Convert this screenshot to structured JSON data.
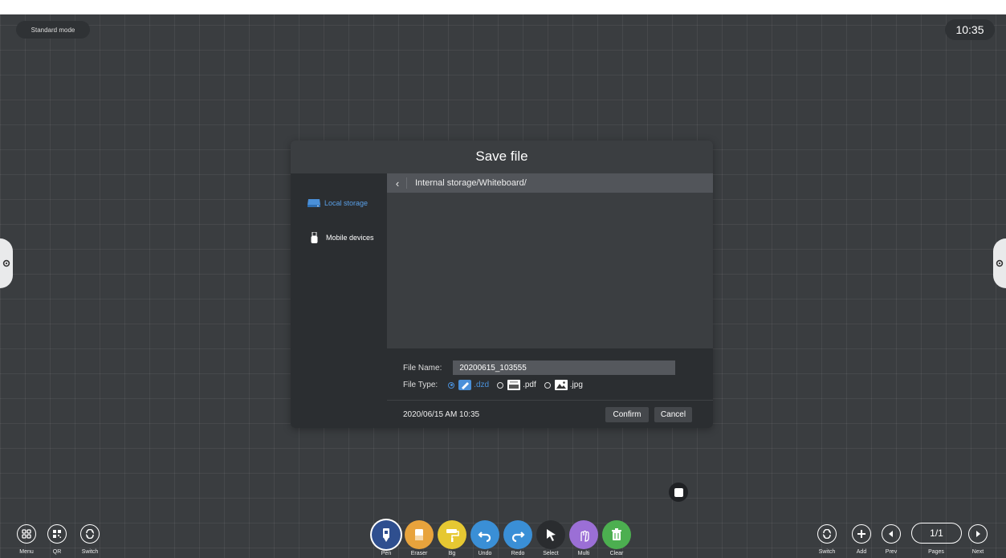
{
  "top_bar": {
    "mode_label": "Standard mode",
    "clock": "10:35"
  },
  "dialog": {
    "title": "Save file",
    "sidebar": [
      {
        "label": "Local storage",
        "icon": "drive-icon",
        "selected": true
      },
      {
        "label": "Mobile devices",
        "icon": "usb-icon",
        "selected": false
      }
    ],
    "path": "Internal storage/Whiteboard/",
    "file_name_label": "File Name:",
    "file_name_value": "20200615_103555",
    "file_type_label": "File Type:",
    "file_types": [
      {
        "label": ".dzd",
        "selected": true
      },
      {
        "label": ".pdf",
        "selected": false
      },
      {
        "label": ".jpg",
        "selected": false
      }
    ],
    "date": "2020/06/15 AM 10:35",
    "confirm_label": "Confirm",
    "cancel_label": "Cancel"
  },
  "left_toolbar": [
    {
      "label": "Menu",
      "icon": "menu-grid-icon"
    },
    {
      "label": "QR",
      "icon": "qr-code-icon"
    },
    {
      "label": "Switch",
      "icon": "switch-icon"
    }
  ],
  "center_toolbar": [
    {
      "label": "Pen",
      "icon": "pen-icon",
      "color": "#2f4f8f",
      "active": true
    },
    {
      "label": "Eraser",
      "icon": "eraser-icon",
      "color": "#e8a33c"
    },
    {
      "label": "Bg",
      "icon": "paint-roller-icon",
      "color": "#e6c832"
    },
    {
      "label": "Undo",
      "icon": "undo-icon",
      "color": "#3a8fd6"
    },
    {
      "label": "Redo",
      "icon": "redo-icon",
      "color": "#3a8fd6"
    },
    {
      "label": "Select",
      "icon": "cursor-icon",
      "color": "#2a2c2f"
    },
    {
      "label": "Multi",
      "icon": "multi-touch-icon",
      "color": "#9b6fd6"
    },
    {
      "label": "Clear",
      "icon": "trash-icon",
      "color": "#4caf50"
    }
  ],
  "right_toolbar": {
    "switch_label": "Switch",
    "add_label": "Add",
    "prev_label": "Prev",
    "pages_label": "Pages",
    "pages_value": "1/1",
    "next_label": "Next"
  }
}
